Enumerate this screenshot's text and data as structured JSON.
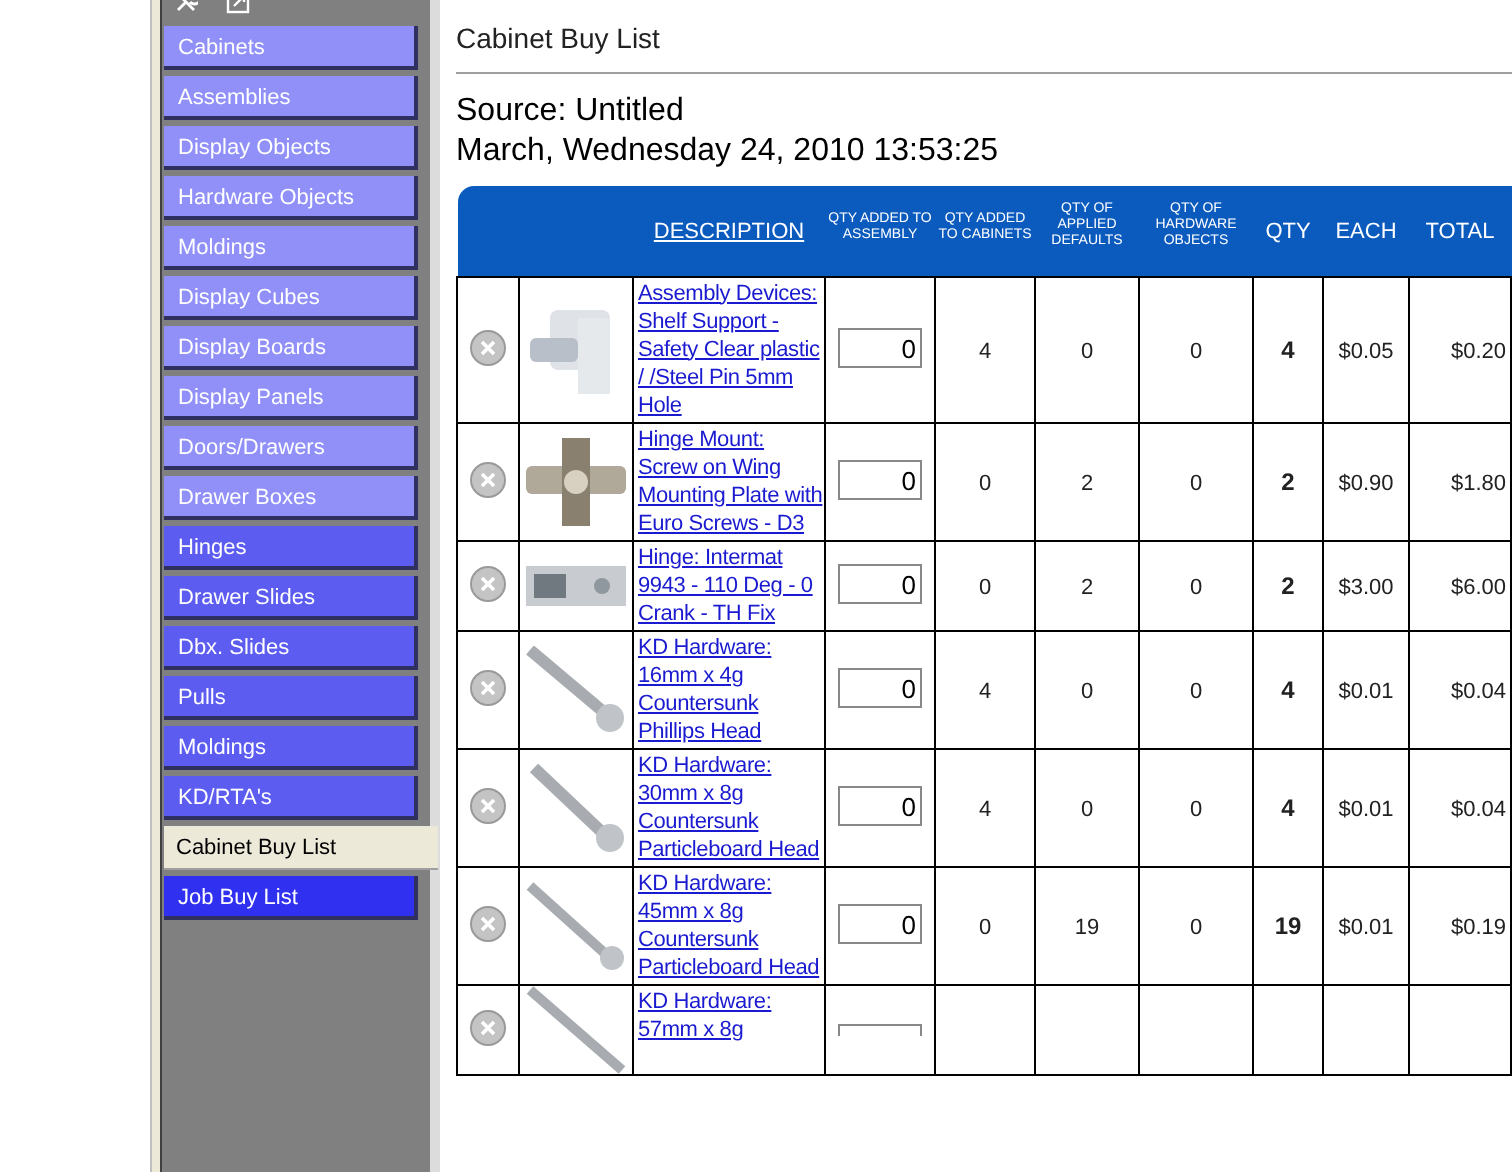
{
  "sidebar": {
    "items": [
      {
        "label": "Cabinets",
        "color": "#9090f8",
        "selected": false
      },
      {
        "label": "Assemblies",
        "color": "#9090f8",
        "selected": false
      },
      {
        "label": "Display Objects",
        "color": "#9090f8",
        "selected": false
      },
      {
        "label": "Hardware Objects",
        "color": "#9090f8",
        "selected": false
      },
      {
        "label": "Moldings",
        "color": "#9090f8",
        "selected": false
      },
      {
        "label": "Display Cubes",
        "color": "#9090f8",
        "selected": false
      },
      {
        "label": "Display Boards",
        "color": "#9090f8",
        "selected": false
      },
      {
        "label": "Display Panels",
        "color": "#9090f8",
        "selected": false
      },
      {
        "label": "Doors/Drawers",
        "color": "#9090f8",
        "selected": false
      },
      {
        "label": "Drawer Boxes",
        "color": "#9090f8",
        "selected": false
      },
      {
        "label": "Hinges",
        "color": "#5c5cf0",
        "selected": false
      },
      {
        "label": "Drawer Slides",
        "color": "#5c5cf0",
        "selected": false
      },
      {
        "label": "Dbx. Slides",
        "color": "#5c5cf0",
        "selected": false
      },
      {
        "label": "Pulls",
        "color": "#5c5cf0",
        "selected": false
      },
      {
        "label": "Moldings",
        "color": "#5c5cf0",
        "selected": false
      },
      {
        "label": "KD/RTA's",
        "color": "#5c5cf0",
        "selected": false
      },
      {
        "label": "Cabinet Buy List",
        "selected": true
      },
      {
        "label": "Job Buy List",
        "color": "#3030f0",
        "selected": false
      }
    ]
  },
  "page": {
    "title": "Cabinet Buy List",
    "source": "Source: Untitled",
    "date": "March, Wednesday 24, 2010 13:53:25"
  },
  "table": {
    "columns": [
      "DESCRIPTION",
      "QTY ADDED TO ASSEMBLY",
      "QTY ADDED TO CABINETS",
      "QTY OF APPLIED DEFAULTS",
      "QTY OF HARDWARE OBJECTS",
      "QTY",
      "EACH",
      "TOTAL"
    ],
    "rows": [
      {
        "description": "Assembly Devices: Shelf Support - Safety Clear plastic / /Steel Pin 5mm Hole ",
        "qty_assembly": "0",
        "qty_cabinets": "4",
        "qty_defaults": "0",
        "qty_hardware": "0",
        "qty": "4",
        "each": "$0.05",
        "total": "$0.20"
      },
      {
        "description": "Hinge Mount: Screw on Wing Mounting Plate with Euro Screws - D3 ",
        "qty_assembly": "0",
        "qty_cabinets": "0",
        "qty_defaults": "2",
        "qty_hardware": "0",
        "qty": "2",
        "each": "$0.90",
        "total": "$1.80"
      },
      {
        "description": "Hinge: Intermat 9943 - 110 Deg - 0 Crank - TH Fix ",
        "qty_assembly": "0",
        "qty_cabinets": "0",
        "qty_defaults": "2",
        "qty_hardware": "0",
        "qty": "2",
        "each": "$3.00",
        "total": "$6.00"
      },
      {
        "description": "KD Hardware: 16mm x 4g Countersunk Phillips Head ",
        "qty_assembly": "0",
        "qty_cabinets": "4",
        "qty_defaults": "0",
        "qty_hardware": "0",
        "qty": "4",
        "each": "$0.01",
        "total": "$0.04"
      },
      {
        "description": "KD Hardware: 30mm x 8g Countersunk Particleboard Head ",
        "qty_assembly": "0",
        "qty_cabinets": "4",
        "qty_defaults": "0",
        "qty_hardware": "0",
        "qty": "4",
        "each": "$0.01",
        "total": "$0.04"
      },
      {
        "description": "KD Hardware: 45mm x 8g Countersunk Particleboard Head ",
        "qty_assembly": "0",
        "qty_cabinets": "0",
        "qty_defaults": "19",
        "qty_hardware": "0",
        "qty": "19",
        "each": "$0.01",
        "total": "$0.19"
      },
      {
        "description": "KD Hardware: 57mm x 8g"
      }
    ]
  }
}
